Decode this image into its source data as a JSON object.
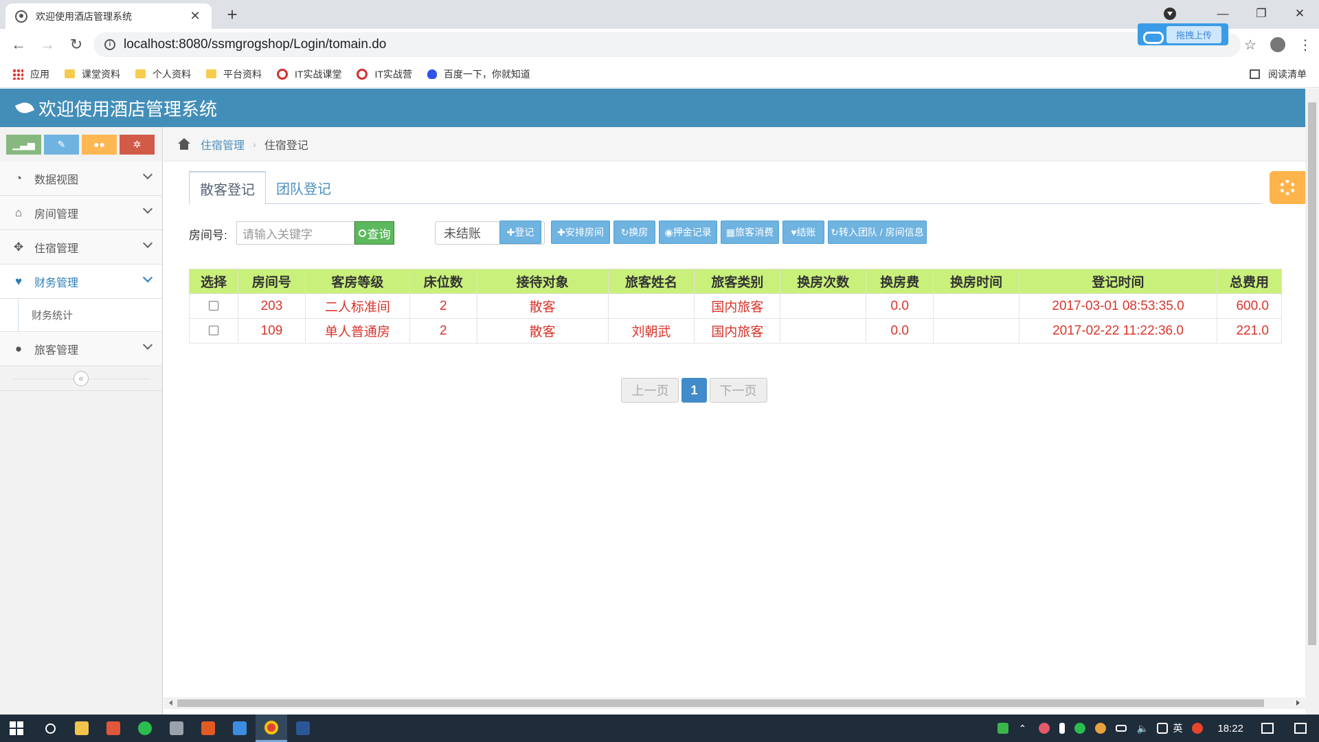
{
  "browser": {
    "tab_title": "欢迎使用酒店管理系统",
    "url": "localhost:8080/ssmgrogshop/Login/tomain.do",
    "upload_widget_label": "拖拽上传",
    "bookmarks": [
      {
        "label": "应用",
        "icon": "apps-grid-icon"
      },
      {
        "label": "课堂资料",
        "icon": "folder-icon"
      },
      {
        "label": "个人资料",
        "icon": "folder-icon"
      },
      {
        "label": "平台资料",
        "icon": "folder-icon"
      },
      {
        "label": "IT实战课堂",
        "icon": "ring-icon"
      },
      {
        "label": "IT实战营",
        "icon": "ring-icon"
      },
      {
        "label": "百度一下，你就知道",
        "icon": "baidu-paw-icon"
      }
    ],
    "reading_list_label": "阅读清单"
  },
  "app": {
    "header_title": "欢迎使用酒店管理系统",
    "colors": {
      "header": "#438eb9",
      "table_header": "#c9f07a",
      "row_text": "#d9342b",
      "action_button": "#6fb3e0"
    }
  },
  "sidebar": {
    "shortcut_icons": [
      "signal-icon",
      "pencil-icon",
      "users-icon",
      "cogs-icon"
    ],
    "items": [
      {
        "label": "数据视图",
        "icon": "dashboard-icon"
      },
      {
        "label": "房间管理",
        "icon": "home-icon"
      },
      {
        "label": "住宿管理",
        "icon": "move-icon"
      },
      {
        "label": "财务管理",
        "icon": "heart-icon",
        "active": true
      },
      {
        "label": "旅客管理",
        "icon": "user-icon"
      }
    ],
    "sub_items": [
      {
        "label": "财务统计"
      }
    ]
  },
  "breadcrumb": {
    "parent": "住宿管理",
    "current": "住宿登记"
  },
  "tabs": [
    {
      "label": "散客登记",
      "active": true
    },
    {
      "label": "团队登记",
      "active": false
    }
  ],
  "filter": {
    "room_label": "房间号:",
    "search_placeholder": "请输入关键字",
    "search_button": "查询",
    "status_selected": "未结账"
  },
  "actions": [
    {
      "label": "✚登记"
    },
    {
      "label": "✚安排房间"
    },
    {
      "label": "↻换房"
    },
    {
      "label": "◉押金记录"
    },
    {
      "label": "▦旅客消费"
    },
    {
      "label": "♥结账"
    },
    {
      "label": "↻转入团队 / 房间信息"
    }
  ],
  "table": {
    "columns": [
      "选择",
      "房间号",
      "客房等级",
      "床位数",
      "接待对象",
      "旅客姓名",
      "旅客类别",
      "换房次数",
      "换房费",
      "换房时间",
      "登记时间",
      "总费用"
    ],
    "rows": [
      [
        "",
        "203",
        "二人标准间",
        "2",
        "散客",
        "",
        "国内旅客",
        "",
        "0.0",
        "",
        "2017-03-01 08:53:35.0",
        "600.0"
      ],
      [
        "",
        "109",
        "单人普通房",
        "2",
        "散客",
        "刘朝武",
        "国内旅客",
        "",
        "0.0",
        "",
        "2017-02-22 11:22:36.0",
        "221.0"
      ]
    ]
  },
  "pagination": {
    "prev": "上一页",
    "current": "1",
    "next": "下一页"
  },
  "taskbar": {
    "clock": "18:22",
    "ime_label": "英"
  }
}
